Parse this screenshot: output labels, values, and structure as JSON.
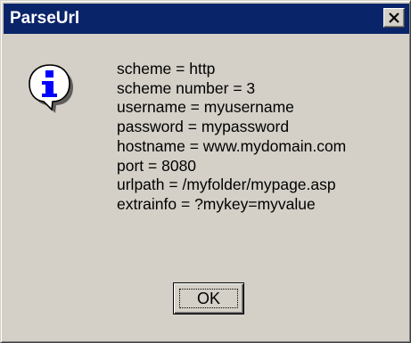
{
  "window": {
    "title": "ParseUrl",
    "close_glyph": "✕"
  },
  "icon": {
    "name": "information-icon",
    "glyph": "i"
  },
  "message": {
    "lines": [
      "scheme = http",
      "scheme number = 3",
      "username = myusername",
      "password = mypassword",
      "hostname = www.mydomain.com",
      "port = 8080",
      "urlpath = /myfolder/mypage.asp",
      "extrainfo = ?mykey=myvalue"
    ]
  },
  "buttons": {
    "ok_label": "OK"
  },
  "colors": {
    "titlebar": "#0a246a",
    "face": "#d4d0c8",
    "icon_blue": "#0000ff"
  }
}
